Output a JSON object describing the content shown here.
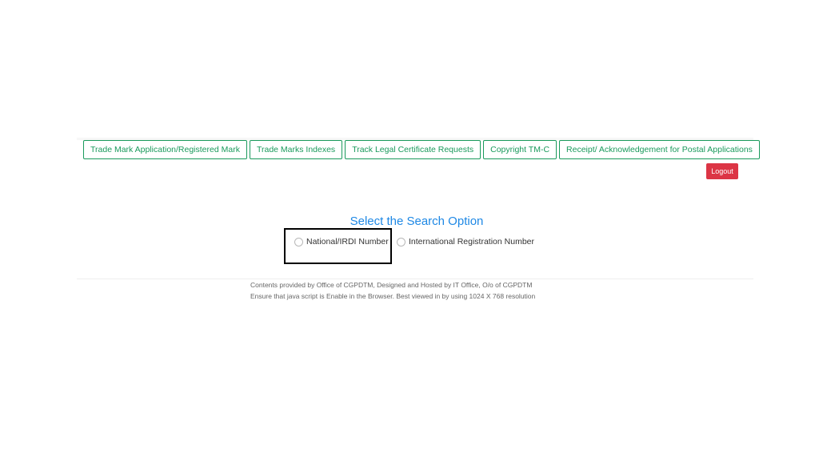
{
  "nav": {
    "items": [
      {
        "label": "Trade Mark Application/Registered Mark"
      },
      {
        "label": "Trade Marks Indexes"
      },
      {
        "label": "Track Legal Certificate Requests"
      },
      {
        "label": "Copyright TM-C"
      },
      {
        "label": "Receipt/ Acknowledgement for Postal Applications"
      }
    ],
    "logout_label": "Logout"
  },
  "search": {
    "title": "Select the Search Option",
    "options": [
      {
        "label": "National/IRDI Number",
        "selected": false
      },
      {
        "label": "International Registration Number",
        "selected": false
      }
    ]
  },
  "footer": {
    "line1": "Contents provided by Office of CGPDTM, Designed and Hosted by IT Office, O/o of CGPDTM",
    "line2": "Ensure that java script is Enable in the Browser. Best viewed in by using 1024 X 768 resolution"
  },
  "colors": {
    "nav_accent": "#1a9a5c",
    "logout_bg": "#dc3545",
    "title_blue": "#1e88e5"
  }
}
